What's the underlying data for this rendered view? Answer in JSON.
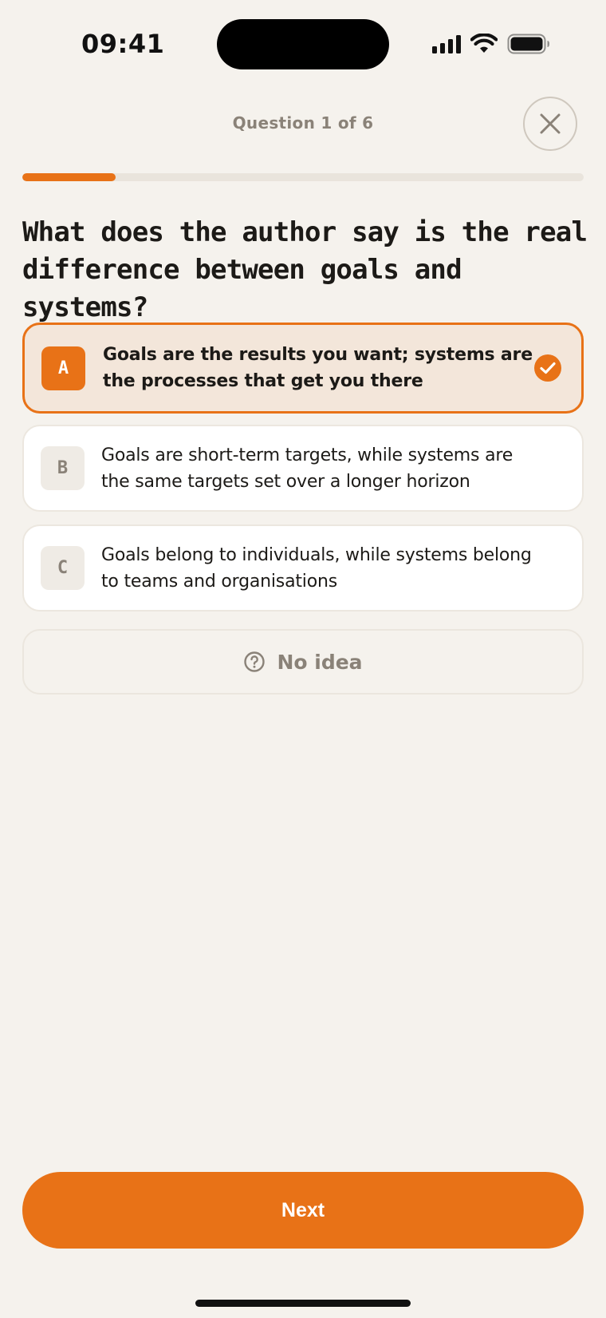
{
  "status_bar": {
    "time": "09:41",
    "icons": [
      "signal-icon",
      "wifi-icon",
      "battery-icon"
    ]
  },
  "header": {
    "counter": "Question 1 of 6",
    "close_icon": "close-icon",
    "progress_fraction": 0.1667
  },
  "question": {
    "text": "What does the author say is the real difference between goals and systems?"
  },
  "options": [
    {
      "letter": "A",
      "text": "Goals are the results you want; systems are the processes that get you there",
      "selected": true
    },
    {
      "letter": "B",
      "text": "Goals are short-term targets, while systems are the same targets set over a longer horizon",
      "selected": false
    },
    {
      "letter": "C",
      "text": "Goals belong to individuals, while systems belong to teams and organisations",
      "selected": false
    }
  ],
  "no_idea": {
    "label": "No idea",
    "icon": "question-circle-icon"
  },
  "footer": {
    "next_label": "Next"
  },
  "colors": {
    "accent": "#e87217",
    "background": "#f5f2ed",
    "selected_bg": "#f3e6da",
    "muted_text": "#8a8278"
  }
}
